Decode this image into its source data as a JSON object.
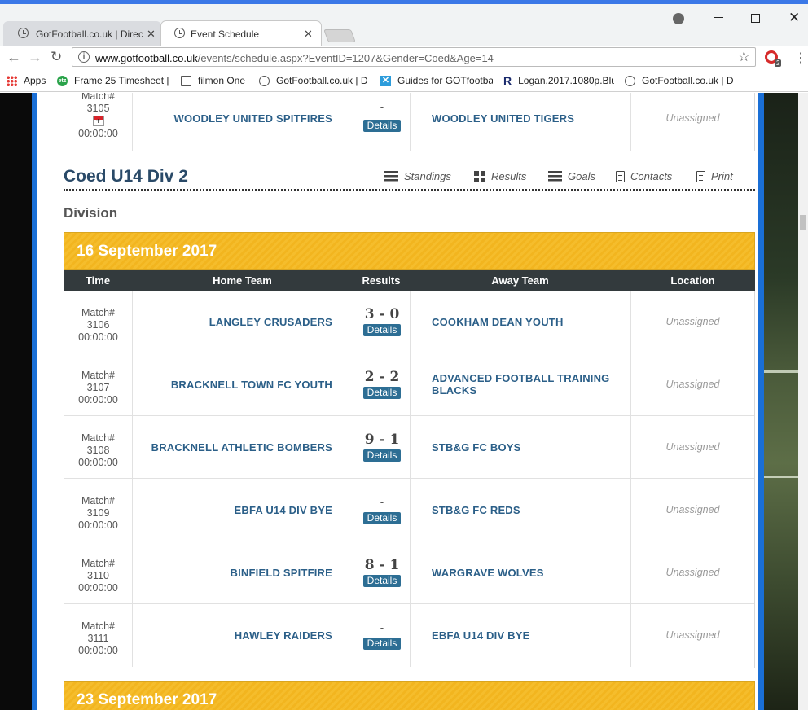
{
  "browser": {
    "tabs": [
      {
        "label": "GotFootball.co.uk | Direct",
        "close": "✕"
      },
      {
        "label": "Event Schedule",
        "close": "✕"
      }
    ],
    "url_host": "www.gotfootball.co.uk",
    "url_path": "/events/schedule.aspx?EventID=1207&Gender=Coed&Age=14",
    "ext_badge": "2",
    "bookmarks": [
      {
        "label": "Apps"
      },
      {
        "label": "Frame 25 Timesheet |"
      },
      {
        "label": "filmon One"
      },
      {
        "label": "GotFootball.co.uk | D"
      },
      {
        "label": "Guides for GOTfootba"
      },
      {
        "label": "Logan.2017.1080p.Blu"
      },
      {
        "label": "GotFootball.co.uk | D"
      }
    ]
  },
  "top_row": {
    "match_label": "Match#",
    "match_no": "3105",
    "time": "00:00:00",
    "home": "WOODLEY UNITED SPITFIRES",
    "score": "-",
    "details": "Details",
    "away": "WOODLEY UNITED TIGERS",
    "location": "Unassigned"
  },
  "division": {
    "title": "Coed U14 Div 2",
    "links": [
      "Standings",
      "Results",
      "Goals",
      "Contacts",
      "Print"
    ],
    "subtitle": "Division",
    "date1": "16 September 2017",
    "date2": "23 September 2017",
    "columns": [
      "Time",
      "Home Team",
      "Results",
      "Away Team",
      "Location"
    ],
    "matches": [
      {
        "label": "Match#",
        "no": "3106",
        "time": "00:00:00",
        "home": "LANGLEY CRUSADERS",
        "score": "3 - 0",
        "details": "Details",
        "away": "COOKHAM DEAN YOUTH",
        "location": "Unassigned"
      },
      {
        "label": "Match#",
        "no": "3107",
        "time": "00:00:00",
        "home": "BRACKNELL TOWN FC YOUTH",
        "score": "2 - 2",
        "details": "Details",
        "away": "ADVANCED FOOTBALL TRAINING BLACKS",
        "location": "Unassigned"
      },
      {
        "label": "Match#",
        "no": "3108",
        "time": "00:00:00",
        "home": "BRACKNELL ATHLETIC BOMBERS",
        "score": "9 - 1",
        "details": "Details",
        "away": "STB&G FC BOYS",
        "location": "Unassigned"
      },
      {
        "label": "Match#",
        "no": "3109",
        "time": "00:00:00",
        "home": "EBFA U14 DIV BYE",
        "score": "-",
        "details": "Details",
        "away": "STB&G FC REDS",
        "location": "Unassigned"
      },
      {
        "label": "Match#",
        "no": "3110",
        "time": "00:00:00",
        "home": "BINFIELD SPITFIRE",
        "score": "8 - 1",
        "details": "Details",
        "away": "WARGRAVE WOLVES",
        "location": "Unassigned"
      },
      {
        "label": "Match#",
        "no": "3111",
        "time": "00:00:00",
        "home": "HAWLEY RAIDERS",
        "score": "-",
        "details": "Details",
        "away": "EBFA U14 DIV BYE",
        "location": "Unassigned"
      }
    ]
  }
}
